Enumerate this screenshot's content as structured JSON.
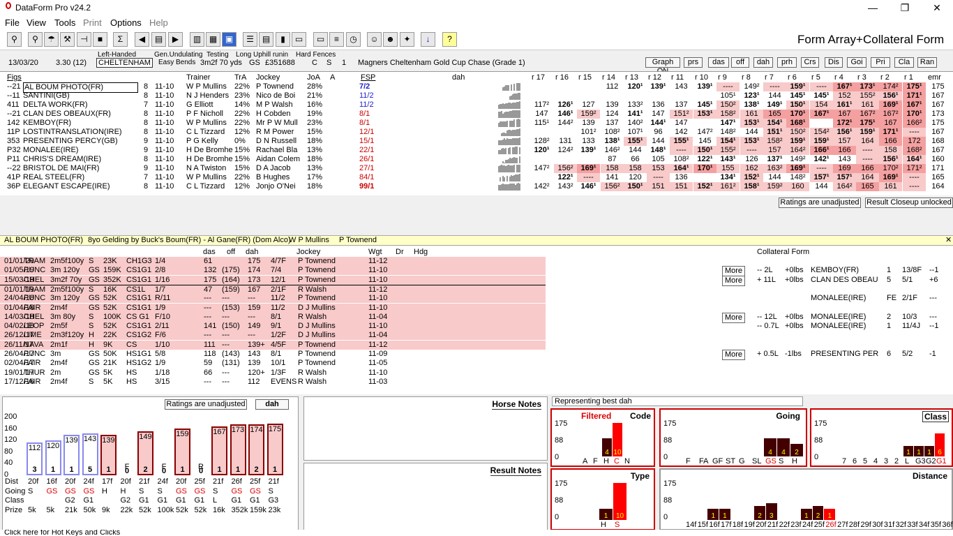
{
  "window": {
    "title": "DataForm Pro v24.2"
  },
  "menu": [
    "File",
    "View",
    "Tools",
    "Print",
    "Options",
    "Help"
  ],
  "toolbar": {
    "view_title": "Form Array+Collateral Form"
  },
  "race": {
    "date": "13/03/20",
    "time": "3.30 (12)",
    "track": "CHELTENHAM",
    "handed": "Left-Handed",
    "undulating": "Gen.Undulating",
    "bends": "Easy Bends",
    "testing": "Testing",
    "dist": "3m2f 70 yds",
    "going": "GS",
    "prize": "£351688",
    "c": "C",
    "s": "S",
    "one": "1",
    "uphill": "Long Uphill runin",
    "fences": "Hard Fences",
    "name": "Magners Cheltenham Gold Cup Chase (Grade 1)"
  },
  "view_buttons": [
    "Graph ON",
    "prs",
    "das",
    "off",
    "dah",
    "prh",
    "Crs",
    "Dis",
    "Goi",
    "Pri",
    "Cla",
    "Ran"
  ],
  "cols": {
    "figs": "Figs",
    "trainer": "Trainer",
    "tra": "TrA",
    "jockey": "Jockey",
    "joa": "JoA",
    "a": "A",
    "fsp": "FSP",
    "dah": "dah",
    "r": [
      "r 17",
      "r 16",
      "r 15",
      "r 14",
      "r 13",
      "r 12",
      "r 11",
      "r 10",
      "r 9",
      "r 8",
      "r 7",
      "r 6",
      "r 5",
      "r 4",
      "r 3",
      "r 2",
      "r 1",
      "emr"
    ]
  },
  "runners": [
    {
      "figs": "--21",
      "name": "AL BOUM PHOTO(FR)",
      "age": "8",
      "wgt": "11-10",
      "trainer": "W P Mullins",
      "tra": "22%",
      "jockey": "P Townend",
      "joa": "28%",
      "fsp": "7/2",
      "r": [
        "",
        "",
        "",
        "112",
        "120¹",
        "139¹",
        "143",
        "139¹",
        "----",
        "149²",
        "----",
        "159¹",
        "----",
        "167¹",
        "173¹",
        "174²",
        "175¹",
        "175"
      ]
    },
    {
      "figs": "--11",
      "name": "SANTINI(GB)",
      "age": "8",
      "wgt": "11-10",
      "trainer": "N J Henders",
      "tra": "23%",
      "jockey": "Nico de Boi",
      "joa": "21%",
      "fsp": "11/2",
      "r": [
        "",
        "",
        "",
        "",
        "",
        "",
        "",
        "",
        "105¹",
        "123¹",
        "144",
        "145¹",
        "145¹",
        "152",
        "155²",
        "156¹",
        "171¹",
        "167"
      ]
    },
    {
      "figs": "411",
      "name": "DELTA WORK(FR)",
      "age": "7",
      "wgt": "11-10",
      "trainer": "G Elliott",
      "tra": "14%",
      "jockey": "M P Walsh",
      "joa": "16%",
      "fsp": "11/2",
      "r": [
        "117²",
        "126¹",
        "127",
        "139",
        "133²",
        "136",
        "137",
        "145¹",
        "150²",
        "138¹",
        "149¹",
        "150¹",
        "154",
        "161¹",
        "161",
        "169¹",
        "167¹",
        "167"
      ]
    },
    {
      "figs": "--21",
      "name": "CLAN DES OBEAUX(FR)",
      "age": "8",
      "wgt": "11-10",
      "trainer": "P F Nicholl",
      "tra": "22%",
      "jockey": "H Cobden",
      "joa": "19%",
      "fsp": "8/1",
      "r": [
        "147",
        "146¹",
        "159²",
        "124",
        "141¹",
        "147",
        "151²",
        "153¹",
        "158²",
        "161",
        "165",
        "170¹",
        "167¹",
        "167",
        "167²",
        "167²",
        "170¹",
        "173"
      ]
    },
    {
      "figs": "142",
      "name": "KEMBOY(FR)",
      "age": "8",
      "wgt": "11-10",
      "trainer": "W P Mullins",
      "tra": "22%",
      "jockey": "Mr P W Mull",
      "joa": "23%",
      "fsp": "8/1",
      "r": [
        "115¹",
        "144²",
        "139",
        "137",
        "140²",
        "144¹",
        "147",
        "",
        "147¹",
        "153¹",
        "154¹",
        "168¹",
        "",
        "172¹",
        "175¹",
        "167",
        "166²",
        "175"
      ]
    },
    {
      "figs": "11P",
      "name": "LOSTINTRANSLATION(IRE)",
      "age": "8",
      "wgt": "11-10",
      "trainer": "C L Tizzard",
      "tra": "12%",
      "jockey": "R M Power",
      "joa": "15%",
      "fsp": "12/1",
      "r": [
        "",
        "",
        "101²",
        "108²",
        "107¹",
        "96",
        "142",
        "147²",
        "148²",
        "144",
        "151¹",
        "150²",
        "154²",
        "156¹",
        "159¹",
        "171¹",
        "----",
        "167"
      ]
    },
    {
      "figs": "353",
      "name": "PRESENTING PERCY(GB)",
      "age": "9",
      "wgt": "11-10",
      "trainer": "P G Kelly",
      "tra": "0%",
      "jockey": "D N Russell",
      "joa": "18%",
      "fsp": "15/1",
      "r": [
        "128²",
        "131",
        "133",
        "138¹",
        "155¹",
        "144",
        "155¹",
        "145",
        "154¹",
        "153¹",
        "158²",
        "159¹",
        "159¹",
        "157",
        "164",
        "166",
        "172",
        "168"
      ]
    },
    {
      "figs": "P32",
      "name": "MONALEE(IRE)",
      "age": "9",
      "wgt": "11-10",
      "trainer": "H De Bromhe",
      "tra": "15%",
      "jockey": "Rachael Bla",
      "joa": "13%",
      "fsp": "22/1",
      "r": [
        "120¹",
        "124²",
        "139¹",
        "146²",
        "144",
        "148¹",
        "----",
        "150¹",
        "155²",
        "----",
        "157",
        "164²",
        "166¹",
        "166",
        "----",
        "158",
        "168²",
        "167"
      ]
    },
    {
      "figs": "P11",
      "name": "CHRIS'S DREAM(IRE)",
      "age": "8",
      "wgt": "11-10",
      "trainer": "H De Bromhe",
      "tra": "15%",
      "jockey": "Aidan Colem",
      "joa": "18%",
      "fsp": "26/1",
      "r": [
        "",
        "",
        "",
        "87",
        "66",
        "105",
        "108²",
        "122¹",
        "143¹",
        "126",
        "137¹",
        "149²",
        "142¹",
        "143",
        "----",
        "156¹",
        "164¹",
        "160"
      ]
    },
    {
      "figs": "--22",
      "name": "BRISTOL DE MAI(FR)",
      "age": "9",
      "wgt": "11-10",
      "trainer": "N A Twiston",
      "tra": "15%",
      "jockey": "D A Jacob",
      "joa": "13%",
      "fsp": "27/1",
      "r": [
        "147²",
        "156²",
        "169¹",
        "158",
        "158",
        "153",
        "164¹",
        "170¹",
        "155",
        "162",
        "163²",
        "169¹",
        "----",
        "169",
        "166",
        "170²",
        "171²",
        "171"
      ]
    },
    {
      "figs": "41P",
      "name": "REAL STEEL(FR)",
      "age": "7",
      "wgt": "11-10",
      "trainer": "W P Mullins",
      "tra": "22%",
      "jockey": "B Hughes",
      "joa": "17%",
      "fsp": "84/1",
      "r": [
        "",
        "122¹",
        "----",
        "141",
        "120",
        "----",
        "136",
        "",
        "134¹",
        "152¹",
        "144",
        "148²",
        "157¹",
        "157¹",
        "164",
        "169¹",
        "----",
        "165"
      ]
    },
    {
      "figs": "36P",
      "name": "ELEGANT ESCAPE(IRE)",
      "age": "8",
      "wgt": "11-10",
      "trainer": "C L Tizzard",
      "tra": "12%",
      "jockey": "Jonjo O'Nei",
      "joa": "18%",
      "fsp": "99/1",
      "r": [
        "142²",
        "143²",
        "146¹",
        "156²",
        "150¹",
        "151",
        "151",
        "152¹",
        "161²",
        "158¹",
        "159²",
        "160",
        "144",
        "164²",
        "165",
        "161",
        "----",
        "164"
      ]
    }
  ],
  "status_buttons": {
    "ratings": "Ratings are unadjusted",
    "closeup": "Result Closeup unlocked"
  },
  "selected": {
    "name": "AL BOUM PHOTO(FR)",
    "desc": "8yo Gelding by Buck's Boum(FR) - Al Gane(FR) (Dom Alco)",
    "trainer": "W P Mullins",
    "jockey": "P Townend"
  },
  "form_cols": {
    "das": "das",
    "off": "off",
    "dah": "dah",
    "jockey": "Jockey",
    "wgt": "Wgt",
    "dr": "Dr",
    "hdg": "Hdg",
    "collateral": "Collateral Form"
  },
  "form": [
    {
      "d": "01/01/20",
      "c": "TRAM",
      "dist": "2m5f100y",
      "g": "S",
      "p": "23K",
      "cl": "CH1G3",
      "pos": "1/4",
      "das": "61",
      "off": "",
      "dah": "175",
      "sp": "4/7F",
      "j": "P Townend",
      "w": "11-12",
      "bg": "pk",
      "more": "",
      "cf": [
        "",
        "",
        "",
        "",
        "",
        ""
      ]
    },
    {
      "d": "01/05/19",
      "c": "PUNC",
      "dist": "3m 120y",
      "g": "GS",
      "p": "159K",
      "cl": "CS1G1",
      "pos": "2/8",
      "das": "132",
      "off": "(175)",
      "dah": "174",
      "sp": "7/4",
      "j": "P Townend",
      "w": "11-10",
      "bg": "pk",
      "more": "More",
      "cf": [
        "-- 2L",
        "+0lbs",
        "KEMBOY(FR)",
        "1",
        "13/8F",
        "--1"
      ]
    },
    {
      "d": "15/03/19",
      "c": "CHEL",
      "dist": "3m2f 70y",
      "g": "GS",
      "p": "352K",
      "cl": "CS1G1",
      "pos": "1/16",
      "das": "175",
      "off": "(164)",
      "dah": "173",
      "sp": "12/1",
      "j": "P Townend",
      "w": "11-10",
      "bg": "pk",
      "more": "More",
      "cf": [
        "+ 11L",
        "+0lbs",
        "CLAN DES OBEAU",
        "5",
        "5/1",
        "+6"
      ]
    },
    {
      "d": "01/01/19",
      "c": "TRAM",
      "dist": "2m5f100y",
      "g": "S",
      "p": "16K",
      "cl": "CS1L",
      "pos": "1/7",
      "das": "47",
      "off": "(159)",
      "dah": "167",
      "sp": "2/1F",
      "j": "R Walsh",
      "w": "11-12",
      "bg": "pk",
      "more": "",
      "cf": [
        "",
        "",
        "",
        "",
        "",
        ""
      ]
    },
    {
      "d": "24/04/18",
      "c": "PUNC",
      "dist": "3m 120y",
      "g": "GS",
      "p": "52K",
      "cl": "CS1G1",
      "pos": "R/11",
      "das": "---",
      "off": "---",
      "dah": "---",
      "sp": "11/2",
      "j": "P Townend",
      "w": "11-10",
      "bg": "pk",
      "more": "",
      "cf": [
        "",
        "",
        "MONALEE(IRE)",
        "FE",
        "2/1F",
        "---"
      ]
    },
    {
      "d": "01/04/18",
      "c": "FAIR",
      "dist": "2m4f",
      "g": "GS",
      "p": "52K",
      "cl": "CS1G1",
      "pos": "1/9",
      "das": "---",
      "off": "(153)",
      "dah": "159",
      "sp": "11/2",
      "j": "D J Mullins",
      "w": "11-10",
      "bg": "pk",
      "more": "",
      "cf": [
        "",
        "",
        "",
        "",
        "",
        ""
      ]
    },
    {
      "d": "14/03/18",
      "c": "CHEL",
      "dist": "3m 80y",
      "g": "S",
      "p": "100K",
      "cl": "CS G1",
      "pos": "F/10",
      "das": "---",
      "off": "---",
      "dah": "---",
      "sp": "8/1",
      "j": "R Walsh",
      "w": "11-04",
      "bg": "pk",
      "more": "More",
      "cf": [
        "-- 12L",
        "+0lbs",
        "MONALEE(IRE)",
        "2",
        "10/3",
        "---"
      ]
    },
    {
      "d": "04/02/18",
      "c": "LEOP",
      "dist": "2m5f",
      "g": "S",
      "p": "52K",
      "cl": "CS1G1",
      "pos": "2/11",
      "das": "141",
      "off": "(150)",
      "dah": "149",
      "sp": "9/1",
      "j": "D J Mullins",
      "w": "11-10",
      "bg": "pk",
      "more": "",
      "cf": [
        "-- 0.7L",
        "+0lbs",
        "MONALEE(IRE)",
        "1",
        "11/4J",
        "--1"
      ]
    },
    {
      "d": "26/12/17",
      "c": "LIME",
      "dist": "2m3f120y",
      "g": "H",
      "p": "22K",
      "cl": "CS1G2",
      "pos": "F/6",
      "das": "---",
      "off": "---",
      "dah": "---",
      "sp": "1/2F",
      "j": "D J Mullins",
      "w": "11-04",
      "bg": "pk",
      "more": "",
      "cf": [
        "",
        "",
        "",
        "",
        "",
        ""
      ]
    },
    {
      "d": "26/11/17",
      "c": "NAVA",
      "dist": "2m1f",
      "g": "H",
      "p": "9K",
      "cl": "CS",
      "pos": "1/10",
      "das": "111",
      "off": "---",
      "dah": "139+",
      "sp": "4/5F",
      "j": "P Townend",
      "w": "11-12",
      "bg": "pk",
      "more": "",
      "cf": [
        "",
        "",
        "",
        "",
        "",
        ""
      ]
    },
    {
      "d": "26/04/17",
      "c": "PUNC",
      "dist": "3m",
      "g": "GS",
      "p": "50K",
      "cl": "HS1G1",
      "pos": "5/8",
      "das": "118",
      "off": "(143)",
      "dah": "143",
      "sp": "8/1",
      "j": "P Townend",
      "w": "11-09",
      "bg": "",
      "more": "More",
      "cf": [
        "+ 0.5L",
        "-1lbs",
        "PRESENTING PER",
        "6",
        "5/2",
        "-1"
      ]
    },
    {
      "d": "02/04/17",
      "c": "FAIR",
      "dist": "2m4f",
      "g": "GS",
      "p": "21K",
      "cl": "HS1G2",
      "pos": "1/9",
      "das": "59",
      "off": "(131)",
      "dah": "139",
      "sp": "10/1",
      "j": "P Townend",
      "w": "11-05",
      "bg": "",
      "more": "",
      "cf": [
        "",
        "",
        "",
        "",
        "",
        ""
      ]
    },
    {
      "d": "19/01/17",
      "c": "THUR",
      "dist": "2m",
      "g": "GS",
      "p": "5K",
      "cl": "HS",
      "pos": "1/18",
      "das": "66",
      "off": "---",
      "dah": "120+",
      "sp": "1/3F",
      "j": "R Walsh",
      "w": "11-10",
      "bg": "",
      "more": "",
      "cf": [
        "",
        "",
        "",
        "",
        "",
        ""
      ]
    },
    {
      "d": "17/12/16",
      "c": "FAIR",
      "dist": "2m4f",
      "g": "S",
      "p": "5K",
      "cl": "HS",
      "pos": "3/15",
      "das": "---",
      "off": "---",
      "dah": "112",
      "sp": "EVENS",
      "j": "R Walsh",
      "w": "11-03",
      "bg": "",
      "more": "",
      "cf": [
        "",
        "",
        "",
        "",
        "",
        ""
      ]
    }
  ],
  "bars": {
    "ratings_btn": "Ratings are unadjusted",
    "dah_btn": "dah",
    "yaxis": [
      "200",
      "160",
      "120",
      "80",
      "40",
      "0"
    ],
    "items": [
      {
        "v": 112,
        "n": "3",
        "f": "",
        "dist": "20f",
        "go": "S",
        "cl": "",
        "pr": "5k",
        "hurdle": true,
        "red": false
      },
      {
        "v": 120,
        "n": "1",
        "f": "",
        "dist": "16f",
        "go": "GS",
        "cl": "",
        "pr": "5k",
        "hurdle": true,
        "red": true
      },
      {
        "v": 139,
        "n": "1",
        "f": "",
        "dist": "20f",
        "go": "GS",
        "cl": "G2",
        "pr": "21k",
        "hurdle": true,
        "red": true
      },
      {
        "v": 143,
        "n": "5",
        "f": "",
        "dist": "24f",
        "go": "GS",
        "cl": "G1",
        "pr": "50k",
        "hurdle": true,
        "red": true
      },
      {
        "v": 139,
        "n": "1",
        "f": "",
        "dist": "17f",
        "go": "H",
        "cl": "",
        "pr": "9k",
        "hurdle": false,
        "red": false
      },
      {
        "v": 0,
        "n": "0",
        "f": "F",
        "dist": "20f",
        "go": "H",
        "cl": "G2",
        "pr": "22k",
        "hurdle": false,
        "red": false
      },
      {
        "v": 149,
        "n": "2",
        "f": "",
        "dist": "21f",
        "go": "S",
        "cl": "G1",
        "pr": "52k",
        "hurdle": false,
        "red": false
      },
      {
        "v": 0,
        "n": "0",
        "f": "F",
        "dist": "24f",
        "go": "S",
        "cl": "G1",
        "pr": "100k",
        "hurdle": false,
        "red": false
      },
      {
        "v": 159,
        "n": "1",
        "f": "",
        "dist": "20f",
        "go": "GS",
        "cl": "G1",
        "pr": "52k",
        "hurdle": false,
        "red": true
      },
      {
        "v": 0,
        "n": "0",
        "f": "R",
        "dist": "25f",
        "go": "GS",
        "cl": "G1",
        "pr": "52k",
        "hurdle": false,
        "red": true
      },
      {
        "v": 167,
        "n": "1",
        "f": "",
        "dist": "21f",
        "go": "S",
        "cl": "L",
        "pr": "16k",
        "hurdle": false,
        "red": false
      },
      {
        "v": 173,
        "n": "1",
        "f": "",
        "dist": "26f",
        "go": "GS",
        "cl": "G1",
        "pr": "352k",
        "hurdle": false,
        "red": true
      },
      {
        "v": 174,
        "n": "2",
        "f": "",
        "dist": "25f",
        "go": "GS",
        "cl": "G1",
        "pr": "159k",
        "hurdle": false,
        "red": true
      },
      {
        "v": 175,
        "n": "1",
        "f": "",
        "dist": "21f",
        "go": "S",
        "cl": "G3",
        "pr": "23k",
        "hurdle": false,
        "red": false
      }
    ],
    "row_labels": [
      "Dist",
      "Going",
      "Class",
      "Prize"
    ]
  },
  "notes": {
    "horse": "Horse Notes",
    "result": "Result Notes"
  },
  "mini": {
    "represent": "Representing best dah",
    "filtered": "Filtered",
    "code": "Code",
    "going": "Going",
    "class": "Class",
    "type": "Type",
    "distance": "Distance",
    "yaxis": [
      "175",
      "88",
      "0"
    ],
    "code_x": [
      "A",
      "F",
      "H",
      "C",
      "N"
    ],
    "code_v": [
      0,
      0,
      4,
      10,
      0
    ],
    "going_x": [
      "F",
      "FA",
      "GF",
      "ST",
      "G",
      "SL",
      "GS",
      "S",
      "H"
    ],
    "going_v": [
      0,
      0,
      0,
      0,
      0,
      0,
      4,
      4,
      2
    ],
    "class_x": [
      "7",
      "6",
      "5",
      "4",
      "3",
      "2",
      "L",
      "G3",
      "G2",
      "G1"
    ],
    "class_v": [
      0,
      0,
      0,
      0,
      0,
      0,
      1,
      1,
      1,
      6
    ],
    "type_x": [
      "H",
      "S"
    ],
    "type_v": [
      1,
      10
    ],
    "dist_x": [
      "14f",
      "15f",
      "16f",
      "17f",
      "18f",
      "19f",
      "20f",
      "21f",
      "22f",
      "23f",
      "24f",
      "25f",
      "26f",
      "27f",
      "28f",
      "29f",
      "30f",
      "31f",
      "32f",
      "33f",
      "34f",
      "35f",
      "36f"
    ],
    "dist_v": [
      0,
      0,
      1,
      1,
      0,
      0,
      2,
      3,
      0,
      0,
      1,
      2,
      1,
      0,
      0,
      0,
      0,
      0,
      0,
      0,
      0,
      0,
      0
    ]
  },
  "statusbar": "Click here for Hot Keys and Clicks"
}
